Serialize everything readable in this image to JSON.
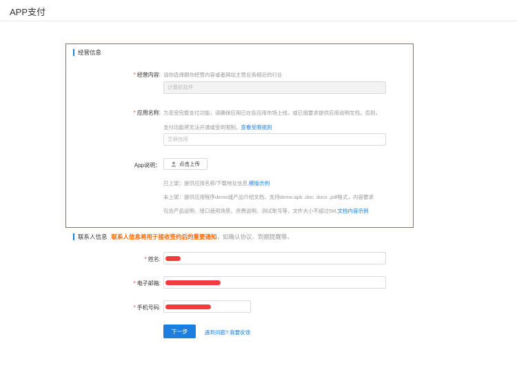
{
  "page": {
    "title": "APP支付"
  },
  "business_section": {
    "title": "经营信息",
    "content": {
      "label": "经营内容:",
      "hint": "请你选择跟你经营内容或者网站主营业务相近的行业",
      "value": "计算机软件"
    },
    "app_name": {
      "label": "应用名称:",
      "hint_line1": "为享受完整支付功能，请确保应用已在各应用市场上线，或已按要求提供应用说明文档。否则，",
      "hint_line2": "支付功能将无法开通或受到限制。",
      "rules_link": "查看受限规则",
      "placeholder": "芝麻信用"
    },
    "app_desc": {
      "label": "App说明：",
      "upload_label": "点击上传",
      "listed_text": "已上架：提供应用名称/下载地址信息,",
      "listed_link": "模版示例",
      "unlisted_line1": "未上架：提供应用程序demo或产品介绍文档，支持demo.apk .doc .docx .pdf格式，内容要求",
      "unlisted_line2": "包含产品说明、接口使用场景、资费说明、测试账号等，文件大小不超过5M,",
      "unlisted_link": "文档内容示例"
    }
  },
  "contact_section": {
    "title": "联系人信息",
    "note": "联系人信息将用于接收签约后的重要通知",
    "note_suffix": "，如确认协议、到期提醒等。",
    "name_label": "姓名:",
    "email_label": "电子邮箱:",
    "phone_label": "手机号码:"
  },
  "actions": {
    "next_label": "下一步",
    "feedback_link": "遇到问题? 我要反馈"
  },
  "colors": {
    "accent": "#1a7fe0",
    "border_highlight": "#e8463c",
    "required": "#e8463c",
    "note": "#ff6600",
    "redaction": "#f03c3c"
  },
  "icons": {
    "upload": "upload-icon"
  }
}
